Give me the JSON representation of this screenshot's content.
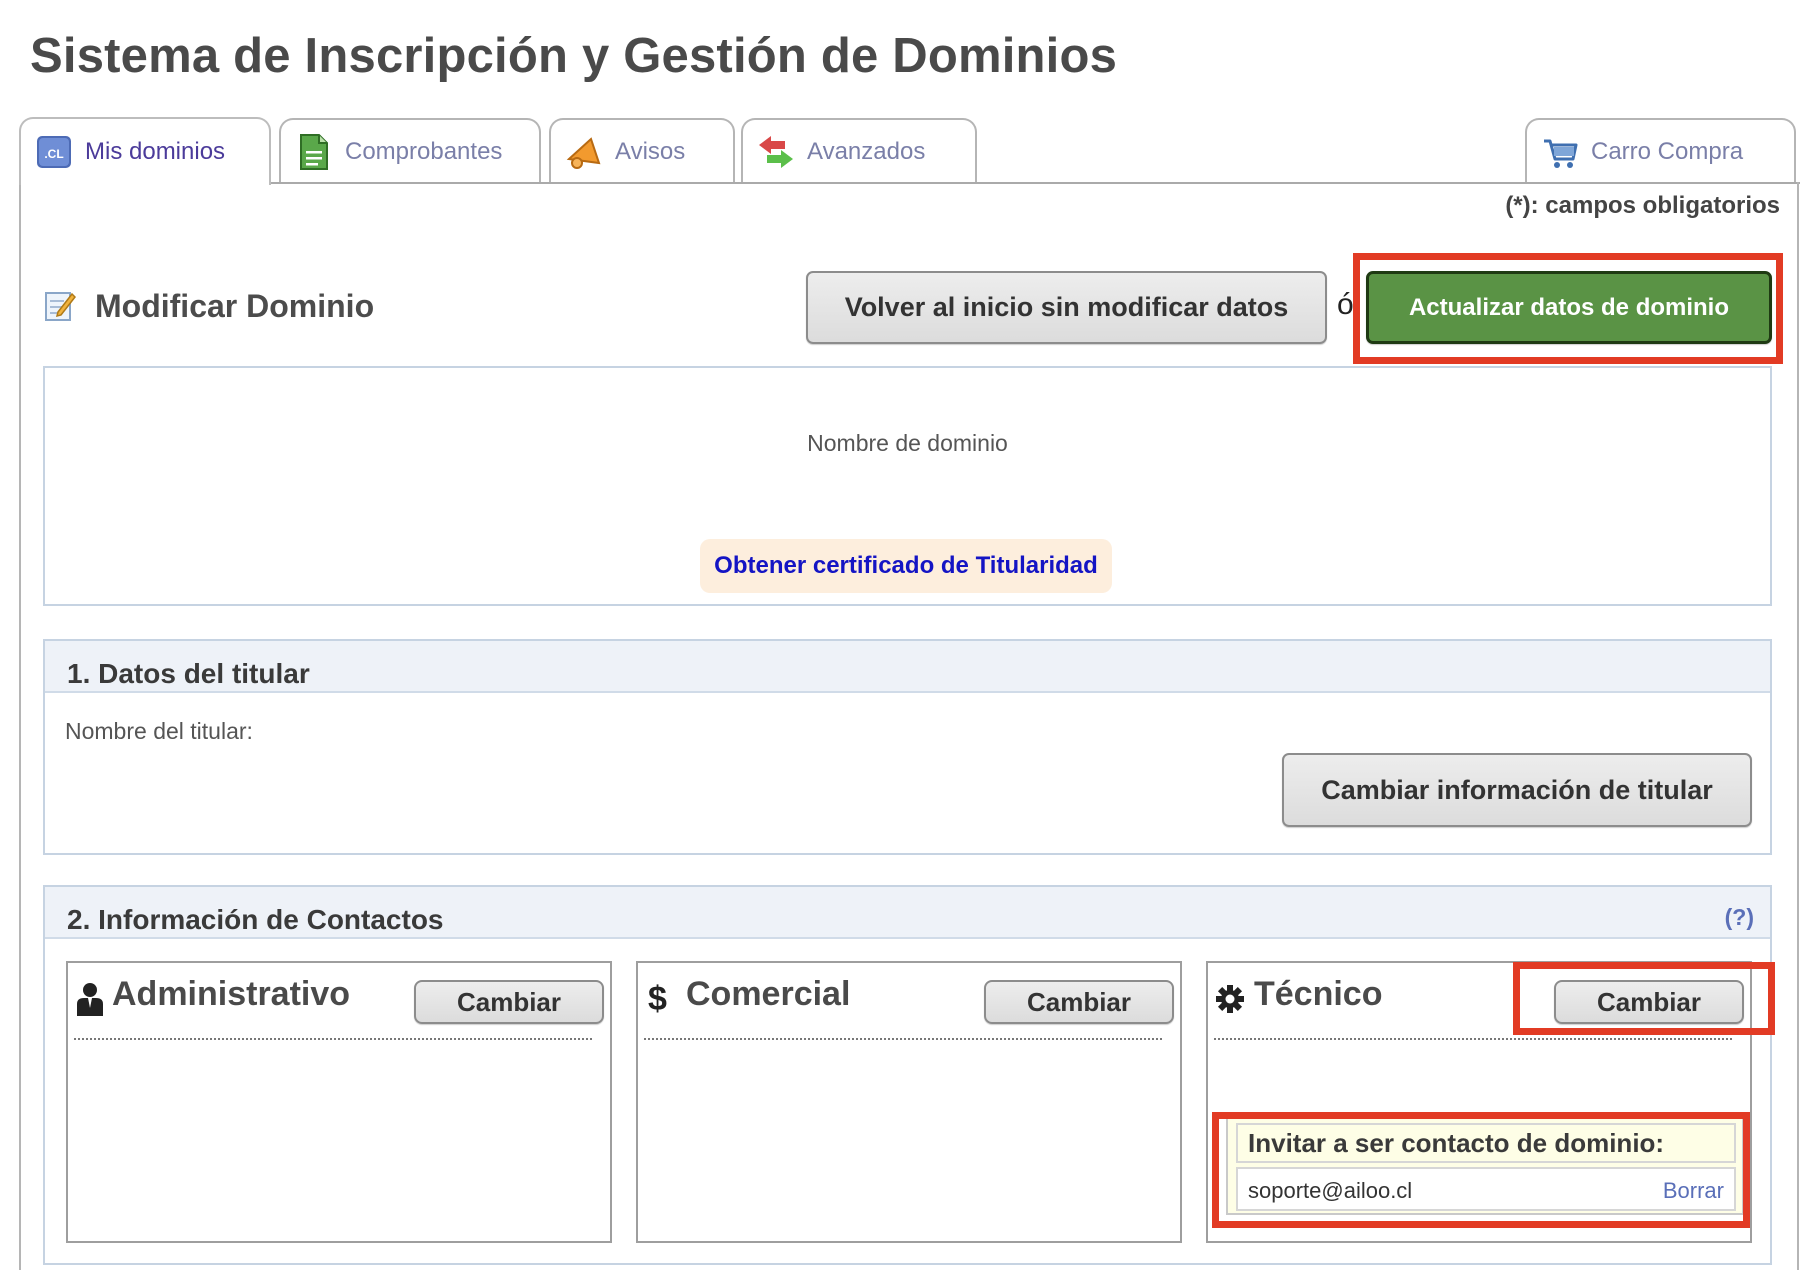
{
  "page": {
    "title": "Sistema de Inscripción y Gestión de Dominios"
  },
  "tabs": [
    {
      "label": "Mis dominios",
      "icon": "cl-domain-icon",
      "active": true
    },
    {
      "label": "Comprobantes",
      "icon": "document-icon",
      "active": false
    },
    {
      "label": "Avisos",
      "icon": "megaphone-icon",
      "active": false
    },
    {
      "label": "Avanzados",
      "icon": "arrows-icon",
      "active": false
    },
    {
      "label": "Carro Compra",
      "icon": "shopping-cart-icon",
      "active": false
    }
  ],
  "required_note": "(*): campos obligatorios",
  "form": {
    "title": "Modificar Dominio",
    "back_button": "Volver al inicio sin modificar datos",
    "or_text": "ó",
    "update_button": "Actualizar datos de dominio"
  },
  "domain": {
    "label": "Nombre de dominio",
    "certificate_link": "Obtener certificado de Titularidad"
  },
  "titular_section": {
    "title": "1. Datos del titular",
    "name_label": "Nombre del titular:",
    "change_button": "Cambiar información de titular"
  },
  "contacts_section": {
    "title": "2. Información de Contactos",
    "help": "(?)",
    "cards": [
      {
        "title": "Administrativo",
        "icon": "person-icon",
        "button": "Cambiar"
      },
      {
        "title": "Comercial",
        "icon": "dollar-icon",
        "button": "Cambiar"
      },
      {
        "title": "Técnico",
        "icon": "gear-icon",
        "button": "Cambiar"
      }
    ],
    "invite": {
      "title": "Invitar a ser contacto de dominio:",
      "email": "soporte@ailoo.cl",
      "delete": "Borrar"
    }
  },
  "colors": {
    "accent_green": "#5a9345",
    "highlight_red": "#e23b24",
    "link_blue": "#1414c4",
    "tab_active_text": "#4b3b9a"
  }
}
